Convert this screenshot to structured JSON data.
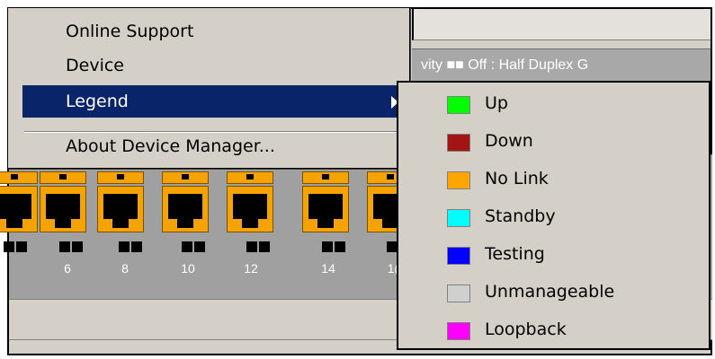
{
  "status_text": "vity ■■ Off : Half Duplex   G",
  "menu": {
    "items": [
      {
        "label": "Online Support"
      },
      {
        "label": "Device"
      },
      {
        "label": "Legend"
      },
      {
        "label": "About Device Manager..."
      }
    ]
  },
  "legend": {
    "items": [
      {
        "label": "Up",
        "color": "#00ff00"
      },
      {
        "label": "Down",
        "color": "#a31515"
      },
      {
        "label": "No Link",
        "color": "#ffa500"
      },
      {
        "label": "Standby",
        "color": "#00ffff"
      },
      {
        "label": "Testing",
        "color": "#0000ff"
      },
      {
        "label": "Unmanageable",
        "color": "#d0d0d0"
      },
      {
        "label": "Loopback",
        "color": "#ff00ff"
      }
    ]
  },
  "ports": {
    "labels": [
      "6",
      "8",
      "10",
      "12",
      "14",
      "1("
    ]
  }
}
